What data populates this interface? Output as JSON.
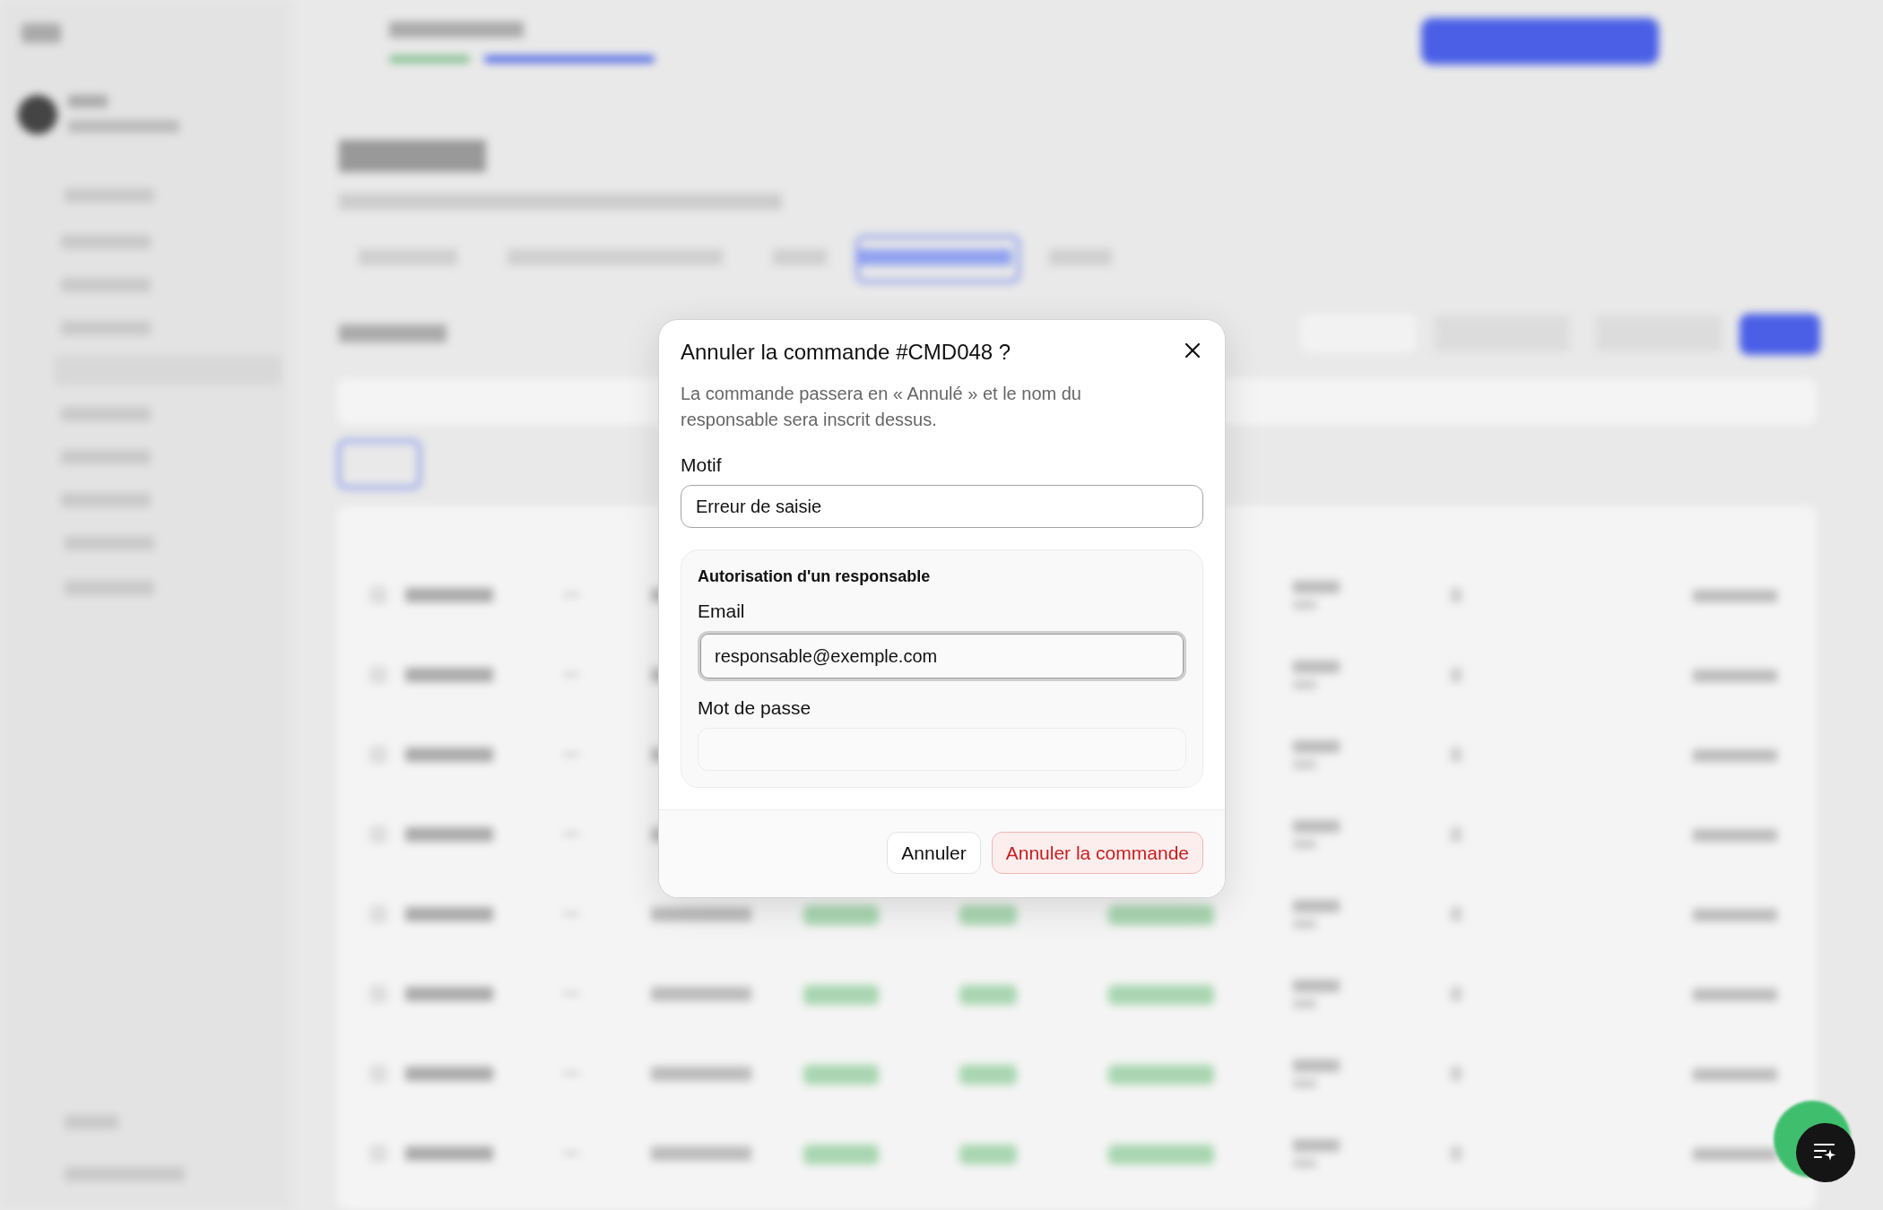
{
  "dialog": {
    "title": "Annuler la commande #CMD048 ?",
    "description": "La commande passera en « Annulé » et le nom du responsable sera inscrit dessus.",
    "reason": {
      "label": "Motif",
      "value": "Erreur de saisie"
    },
    "authorization": {
      "title": "Autorisation d'un responsable",
      "fields": [
        {
          "label": "Email",
          "value": "responsable@exemple.com",
          "focused": true
        },
        {
          "label": "Mot de passe",
          "focused": false
        }
      ]
    },
    "buttons": [
      {
        "label": "Annuler",
        "kind": "secondary"
      },
      {
        "label": "Annuler la commande",
        "kind": "danger"
      }
    ]
  }
}
